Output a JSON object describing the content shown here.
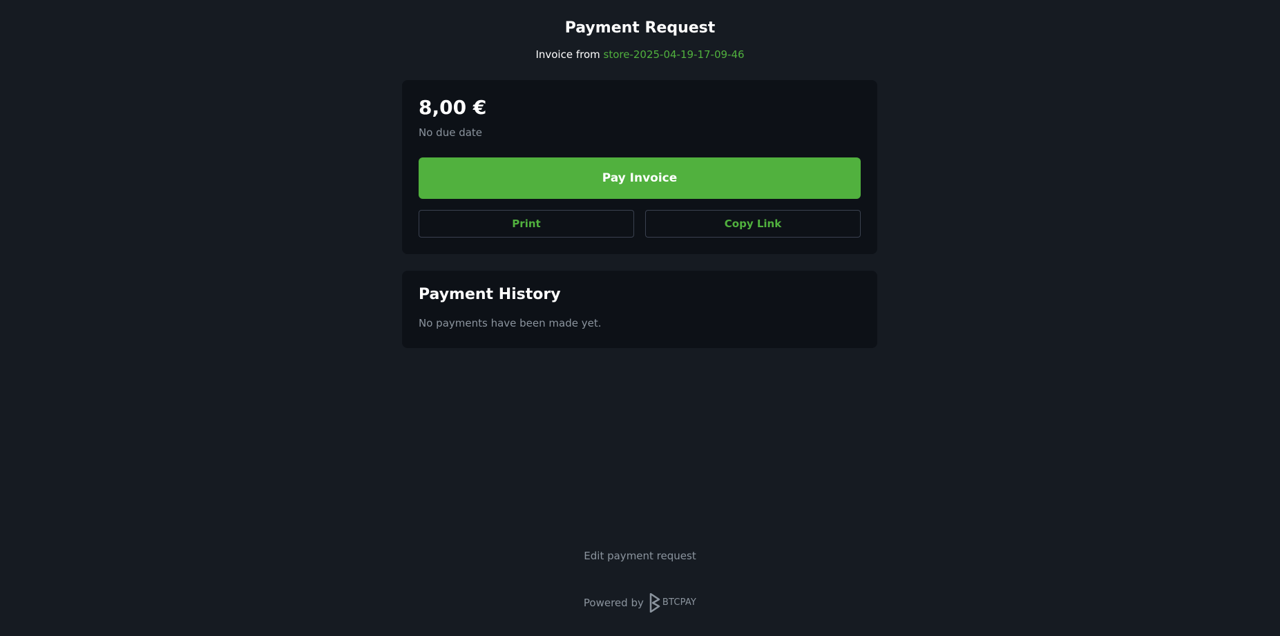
{
  "header": {
    "title": "Payment Request",
    "invoice_from_label": "Invoice from",
    "store_name": "store-2025-04-19-17-09-46"
  },
  "invoice": {
    "amount": "8,00 €",
    "due_date": "No due date",
    "pay_button": "Pay Invoice",
    "print_button": "Print",
    "copy_link_button": "Copy Link"
  },
  "history": {
    "title": "Payment History",
    "empty_message": "No payments have been made yet."
  },
  "footer": {
    "edit_link": "Edit payment request",
    "powered_by": "Powered by",
    "brand": "BTCPAY",
    "brand_icon": "btcpay-logo-icon"
  },
  "colors": {
    "background": "#161b22",
    "card": "#0d1117",
    "accent": "#51b13e",
    "muted_text": "#8b949e",
    "border": "#3a4150"
  }
}
